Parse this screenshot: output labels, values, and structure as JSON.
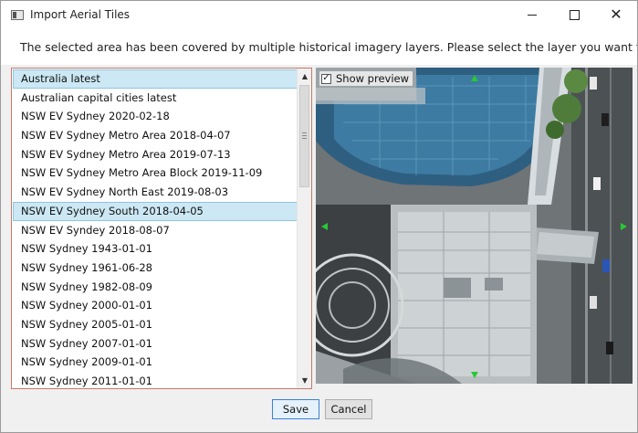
{
  "window": {
    "title": "Import Aerial Tiles",
    "controls": {
      "minimize": "—",
      "maximize": "☐",
      "close": "✕"
    }
  },
  "header": {
    "icon": "globe-icon",
    "message": "The selected area has been covered by multiple historical imagery layers. Please select the layer you want to import."
  },
  "layers": {
    "selected_index": 7,
    "items": [
      "Australia latest",
      "Australian capital cities latest",
      "NSW EV Sydney 2020-02-18",
      "NSW EV Sydney Metro Area 2018-04-07",
      "NSW EV Sydney Metro Area 2019-07-13",
      "NSW EV Sydney Metro Area Block 2019-11-09",
      "NSW EV Sydney North East 2019-08-03",
      "NSW EV Sydney South 2018-04-05",
      "NSW EV Syndey 2018-08-07",
      "NSW Sydney 1943-01-01",
      "NSW Sydney 1961-06-28",
      "NSW Sydney 1982-08-09",
      "NSW Sydney 2000-01-01",
      "NSW Sydney 2005-01-01",
      "NSW Sydney 2007-01-01",
      "NSW Sydney 2009-01-01",
      "NSW Sydney 2011-01-01"
    ]
  },
  "preview": {
    "show_preview_label": "Show preview",
    "show_preview_checked": true
  },
  "footer": {
    "save_label": "Save",
    "cancel_label": "Cancel"
  }
}
